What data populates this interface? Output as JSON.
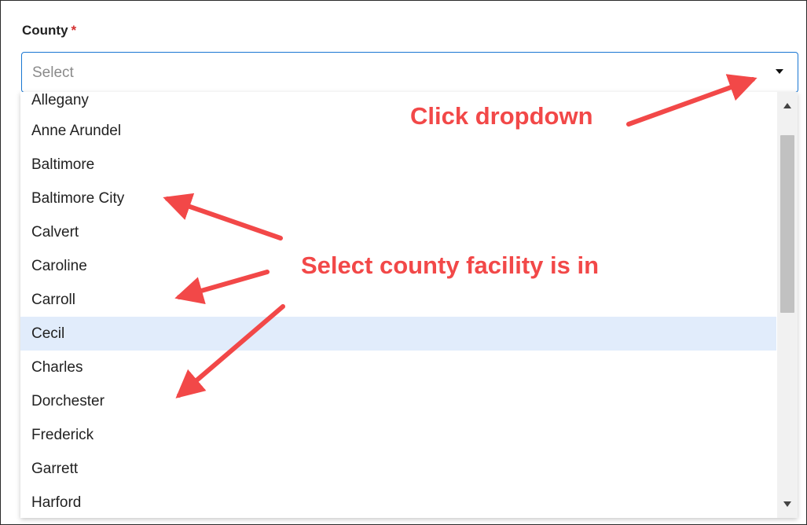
{
  "field": {
    "label": "County",
    "required_marker": "*",
    "placeholder": "Select"
  },
  "dropdown": {
    "options": [
      "Allegany",
      "Anne Arundel",
      "Baltimore",
      "Baltimore City",
      "Calvert",
      "Caroline",
      "Carroll",
      "Cecil",
      "Charles",
      "Dorchester",
      "Frederick",
      "Garrett",
      "Harford"
    ],
    "highlighted_option": "Cecil"
  },
  "annotations": {
    "click_dropdown": "Click dropdown",
    "select_county": "Select county facility is in",
    "color": "#f24848"
  },
  "colors": {
    "focus_border": "#1976d2",
    "highlight_bg": "#e1ecfb",
    "required": "#d32f2f"
  }
}
